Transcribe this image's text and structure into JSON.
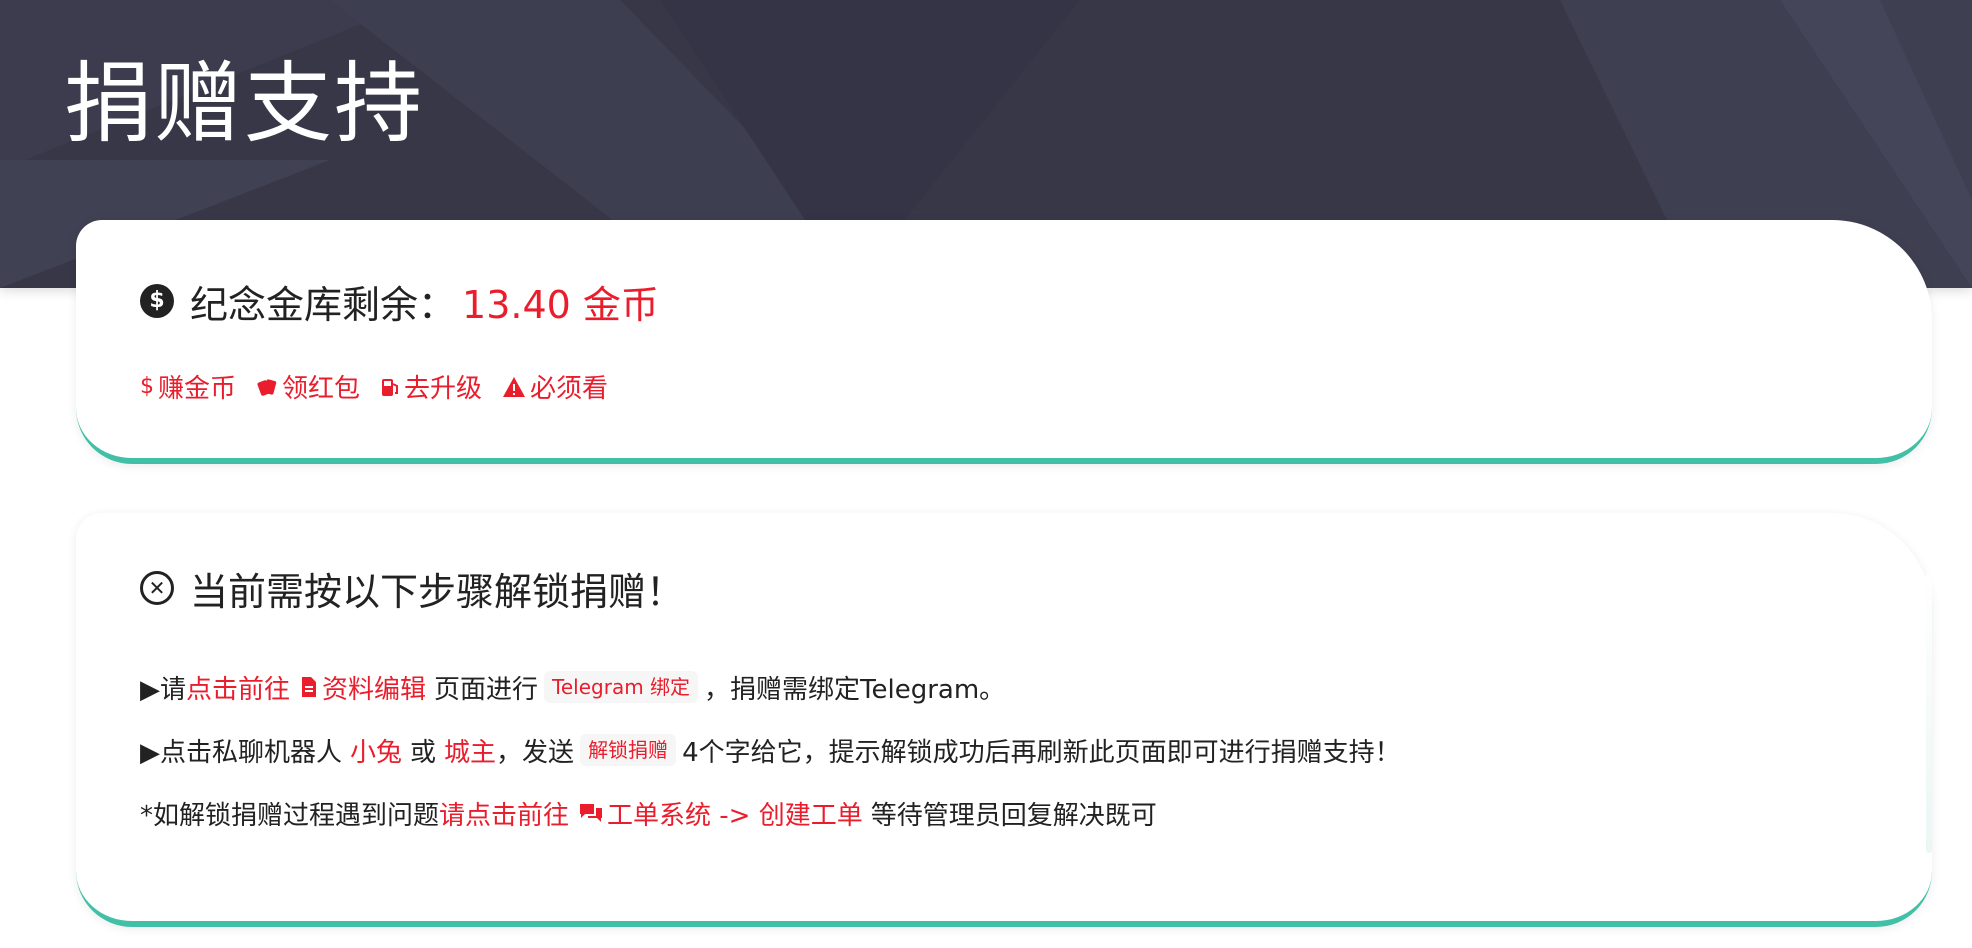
{
  "page": {
    "title": "捐赠支持"
  },
  "colors": {
    "accent": "#ea1d2c",
    "card_border": "#42bfa7",
    "hero_bg": "#373748"
  },
  "vault": {
    "icon": "dollar-circle-icon",
    "label": "纪念金库剩余：",
    "value": "13.40 金币",
    "links": [
      {
        "icon": "dollar-icon",
        "label": "赚金币"
      },
      {
        "icon": "red-packet-icon",
        "label": "领红包"
      },
      {
        "icon": "fuel-icon",
        "label": "去升级"
      },
      {
        "icon": "warning-icon",
        "label": "必须看"
      }
    ]
  },
  "unlock": {
    "icon": "x-circle-icon",
    "title": "当前需按以下步骤解锁捐赠！",
    "step1": {
      "prefix": "▶请",
      "link1": "点击前往",
      "icon": "document-icon",
      "link2": "资料编辑",
      "middle": "页面进行",
      "code": "Telegram 绑定",
      "suffix": "，捐赠需绑定Telegram。"
    },
    "step2": {
      "prefix": "▶点击私聊机器人",
      "bot1": "小兔",
      "or": "或",
      "bot2": "城主",
      "send": "，发送",
      "code": "解锁捐赠",
      "suffix": "4个字给它，提示解锁成功后再刷新此页面即可进行捐赠支持！"
    },
    "step3": {
      "prefix": "*如解锁捐赠过程遇到问题",
      "link1": "请点击前往",
      "icon": "chat-icon",
      "link2": "工单系统 -> 创建工单",
      "suffix": "等待管理员回复解决既可"
    }
  }
}
